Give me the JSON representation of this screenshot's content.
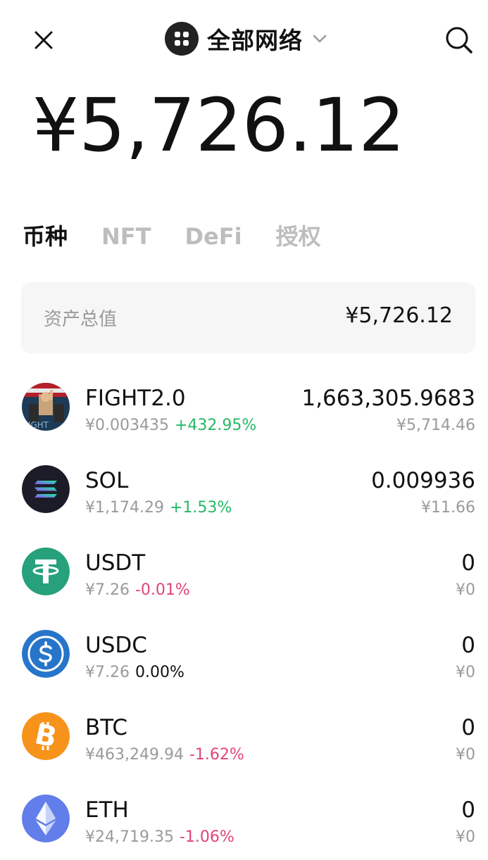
{
  "header": {
    "close_icon": "close-icon",
    "network_icon": "four-dots-icon",
    "network_label": "全部网络",
    "chevron_icon": "chevron-down-icon",
    "search_icon": "search-icon"
  },
  "balance": {
    "total": "¥5,726.12"
  },
  "tabs": [
    {
      "label": "币种",
      "active": true
    },
    {
      "label": "NFT",
      "active": false
    },
    {
      "label": "DeFi",
      "active": false
    },
    {
      "label": "授权",
      "active": false
    }
  ],
  "summary": {
    "label": "资产总值",
    "value": "¥5,726.12"
  },
  "tokens": [
    {
      "symbol": "FIGHT2.0",
      "price": "¥0.003435",
      "change": "+432.95%",
      "direction": "up",
      "amount": "1,663,305.9683",
      "fiat": "¥5,714.46",
      "icon": "fight-token-icon"
    },
    {
      "symbol": "SOL",
      "price": "¥1,174.29",
      "change": "+1.53%",
      "direction": "up",
      "amount": "0.009936",
      "fiat": "¥11.66",
      "icon": "solana-icon"
    },
    {
      "symbol": "USDT",
      "price": "¥7.26",
      "change": "-0.01%",
      "direction": "down",
      "amount": "0",
      "fiat": "¥0",
      "icon": "tether-icon"
    },
    {
      "symbol": "USDC",
      "price": "¥7.26",
      "change": "0.00%",
      "direction": "flat",
      "amount": "0",
      "fiat": "¥0",
      "icon": "usdc-icon"
    },
    {
      "symbol": "BTC",
      "price": "¥463,249.94",
      "change": "-1.62%",
      "direction": "down",
      "amount": "0",
      "fiat": "¥0",
      "icon": "bitcoin-icon"
    },
    {
      "symbol": "ETH",
      "price": "¥24,719.35",
      "change": "-1.06%",
      "direction": "down",
      "amount": "0",
      "fiat": "¥0",
      "icon": "ethereum-icon"
    }
  ],
  "colors": {
    "up": "#25b865",
    "down": "#e0457b",
    "muted": "#9a9a9a",
    "tab_inactive": "#bdbdbd"
  }
}
